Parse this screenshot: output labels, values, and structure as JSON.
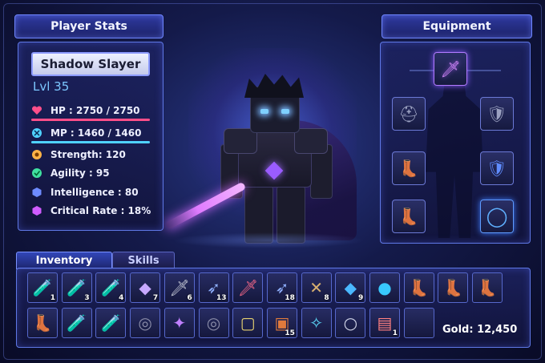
{
  "player_stats_tab": "Player Stats",
  "equipment_tab": "Equipment",
  "character": {
    "name": "Shadow Slayer",
    "level": "Lvl 35"
  },
  "stats": {
    "hp": {
      "label": "HP :  2750 / 2750",
      "value": 2750,
      "max": 2750,
      "color": "#ff4f8a",
      "icon": "heart-icon"
    },
    "mp": {
      "label": "MP :  1460 / 1460",
      "value": 1460,
      "max": 1460,
      "color": "#4fd2ff",
      "icon": "mana-crystal-icon"
    },
    "strength": {
      "label": "Strength: 120",
      "color": "#ffb347",
      "icon": "strength-icon"
    },
    "agility": {
      "label": "Agility :  95",
      "color": "#3fe0a0",
      "icon": "agility-icon"
    },
    "intelligence": {
      "label": "Intelligence : 80",
      "color": "#6e8bff",
      "icon": "intelligence-icon"
    },
    "critical": {
      "label": "Critical Rate : 18%",
      "color": "#d05cff",
      "icon": "critical-icon"
    }
  },
  "equipment": {
    "weapon": {
      "icon": "purple-sword-icon",
      "glyph": "🗡"
    },
    "helmet": {
      "icon": "helmet-icon",
      "glyph": "⛑"
    },
    "shoulder": {
      "icon": "shoulder-armor-icon",
      "glyph": "🛡"
    },
    "gloves": {
      "icon": "boots-icon",
      "glyph": "👢"
    },
    "chest": {
      "icon": "chest-armor-icon",
      "glyph": "🛡"
    },
    "boots": {
      "icon": "boots-icon",
      "glyph": "👢"
    },
    "ring": {
      "icon": "ring-icon",
      "glyph": "◯"
    }
  },
  "inventory": {
    "tabs": [
      "Inventory",
      "Skills"
    ],
    "row1": [
      {
        "icon": "red-potion-icon",
        "glyph": "🧪",
        "qty": "1"
      },
      {
        "icon": "blue-potion-icon",
        "glyph": "🧪",
        "qty": "3"
      },
      {
        "icon": "purple-potion-icon",
        "glyph": "🧪",
        "qty": "4"
      },
      {
        "icon": "crystal-icon",
        "glyph": "◆",
        "qty": "7"
      },
      {
        "icon": "dagger-icon",
        "glyph": "🗡",
        "qty": "6"
      },
      {
        "icon": "arrow-icon",
        "glyph": "➶",
        "qty": "13"
      },
      {
        "icon": "red-sword-icon",
        "glyph": "🗡",
        "qty": ""
      },
      {
        "icon": "arrow-icon",
        "glyph": "➶",
        "qty": "18"
      },
      {
        "icon": "crossbow-icon",
        "glyph": "✕",
        "qty": "8"
      },
      {
        "icon": "blue-gem-icon",
        "glyph": "◆",
        "qty": "9"
      },
      {
        "icon": "orb-icon",
        "glyph": "●",
        "qty": ""
      },
      {
        "icon": "leather-boots-icon",
        "glyph": "👢",
        "qty": ""
      },
      {
        "icon": "boots-icon",
        "glyph": "👢",
        "qty": ""
      },
      {
        "icon": "boots-icon",
        "glyph": "👢",
        "qty": ""
      }
    ],
    "row2": [
      {
        "icon": "boots-icon",
        "glyph": "👢",
        "qty": ""
      },
      {
        "icon": "blue-potion-icon",
        "glyph": "🧪",
        "qty": ""
      },
      {
        "icon": "pink-potion-icon",
        "glyph": "🧪",
        "qty": ""
      },
      {
        "icon": "dark-ring-icon",
        "glyph": "◎",
        "qty": ""
      },
      {
        "icon": "purple-crystal-icon",
        "glyph": "✦",
        "qty": ""
      },
      {
        "icon": "dark-ring-icon",
        "glyph": "◎",
        "qty": ""
      },
      {
        "icon": "gold-ring-icon",
        "glyph": "▢",
        "qty": ""
      },
      {
        "icon": "treasure-chest-icon",
        "glyph": "▣",
        "qty": "15"
      },
      {
        "icon": "amulet-icon",
        "glyph": "✧",
        "qty": ""
      },
      {
        "icon": "necklace-icon",
        "glyph": "○",
        "qty": ""
      },
      {
        "icon": "spellbook-icon",
        "glyph": "▤",
        "qty": "1"
      },
      {
        "icon": "empty-slot",
        "glyph": "",
        "qty": ""
      }
    ]
  },
  "gold": "Gold: 12,450"
}
